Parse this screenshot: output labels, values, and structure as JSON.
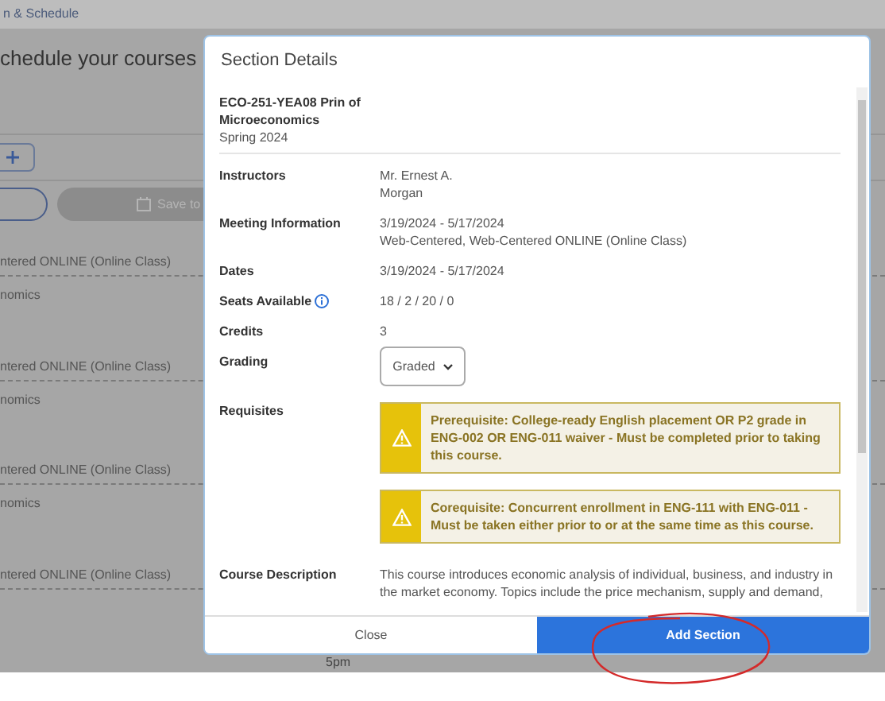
{
  "background": {
    "breadcrumb": "n & Schedule",
    "heading": "chedule your courses",
    "save_button": "Save to",
    "rows": [
      {
        "meeting": "ntered ONLINE (Online Class)",
        "title": "nomics"
      },
      {
        "meeting": "ntered ONLINE (Online Class)",
        "title": "nomics"
      },
      {
        "meeting": "ntered ONLINE (Online Class)",
        "title": "nomics"
      },
      {
        "meeting": "ntered ONLINE (Online Class)"
      }
    ],
    "time_label": "5pm"
  },
  "dialog": {
    "title": "Section Details",
    "course": {
      "name": "ECO-251-YEA08 Prin of Microeconomics",
      "term": "Spring 2024"
    },
    "details": [
      {
        "kind": "text",
        "label": "Instructors",
        "lines": [
          "Mr. Ernest A.",
          "Morgan"
        ]
      },
      {
        "kind": "text",
        "label": "Meeting Information",
        "lines": [
          "3/19/2024 - 5/17/2024",
          "Web-Centered, Web-Centered ONLINE (Online Class)"
        ]
      },
      {
        "kind": "text",
        "label": "Dates",
        "lines": [
          "3/19/2024 - 5/17/2024"
        ]
      },
      {
        "kind": "info",
        "label": "Seats Available",
        "lines": [
          "18 / 2 / 20 / 0"
        ]
      },
      {
        "kind": "text",
        "label": "Credits",
        "lines": [
          "3"
        ]
      },
      {
        "kind": "select",
        "label": "Grading",
        "value": "Graded"
      },
      {
        "kind": "requisites",
        "label": "Requisites",
        "items": [
          "Prerequisite: College-ready English placement OR P2 grade in ENG-002 OR ENG-011 waiver - Must be completed prior to taking this course.",
          "Corequisite: Concurrent enrollment in ENG-111 with ENG-011 - Must be taken either prior to or at the same time as this course."
        ]
      },
      {
        "kind": "paragraph",
        "label": "Course Description",
        "text": "This course introduces economic analysis of individual, business, and industry in the market economy. Topics include the price mechanism, supply and demand,"
      }
    ],
    "buttons": [
      {
        "label": "Close",
        "primary": false
      },
      {
        "label": "Add Section",
        "primary": true
      }
    ]
  }
}
